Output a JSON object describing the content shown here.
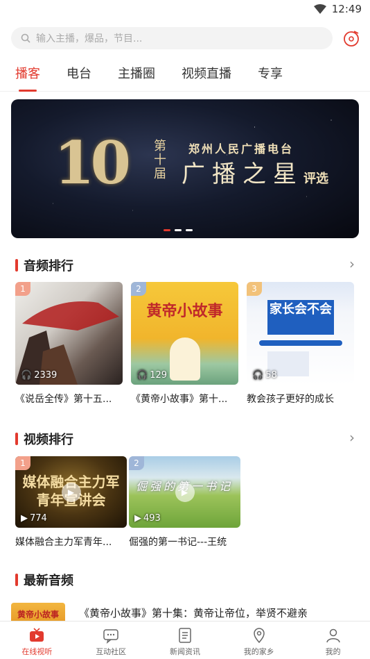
{
  "status": {
    "time": "12:49"
  },
  "search": {
    "placeholder": "输入主播，爆品，节目..."
  },
  "tabs": [
    {
      "label": "播客",
      "active": true
    },
    {
      "label": "电台"
    },
    {
      "label": "主播圈"
    },
    {
      "label": "视频直播"
    },
    {
      "label": "专享"
    }
  ],
  "banner": {
    "big_number": "10",
    "edition": "第十届",
    "org": "郑州人民广播电台",
    "main": "广播之星",
    "select": "评选"
  },
  "audio_rank": {
    "title": "音频排行",
    "items": [
      {
        "rank": "1",
        "plays": "2339",
        "title": "《说岳全传》第十五...",
        "thumb_text": ""
      },
      {
        "rank": "2",
        "plays": "129",
        "title": "《黄帝小故事》第十...",
        "thumb_text": "黄帝小故事"
      },
      {
        "rank": "3",
        "plays": "58",
        "title": "教会孩子更好的成长",
        "thumb_text": "家长会不会"
      }
    ]
  },
  "video_rank": {
    "title": "视频排行",
    "items": [
      {
        "rank": "1",
        "plays": "774",
        "title": "媒体融合主力军青年...",
        "thumb_text": "媒体融合主力军青年宣讲会"
      },
      {
        "rank": "2",
        "plays": "493",
        "title": "倔强的第一书记---王统",
        "thumb_text": "倔强的第一书记"
      }
    ]
  },
  "newest_audio": {
    "title": "最新音频",
    "items": [
      {
        "title": "《黄帝小故事》第十集：黄帝让帝位，举贤不避亲",
        "thumb_text": "黄帝小故事"
      }
    ]
  },
  "tabbar": [
    {
      "label": "在线视听",
      "icon": "play-tv-icon",
      "active": true
    },
    {
      "label": "互动社区",
      "icon": "chat-icon"
    },
    {
      "label": "新闻资讯",
      "icon": "news-icon"
    },
    {
      "label": "我的家乡",
      "icon": "location-icon"
    },
    {
      "label": "我的",
      "icon": "user-icon"
    }
  ],
  "colors": {
    "accent": "#e23a2e"
  }
}
